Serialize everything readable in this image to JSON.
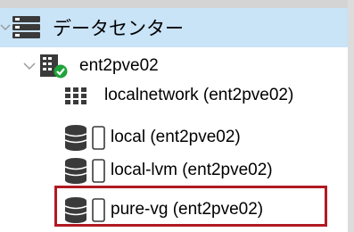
{
  "tree": {
    "datacenter": {
      "label": "データセンター",
      "icon": "server-stack-icon",
      "expanded": true
    },
    "node": {
      "label": "ent2pve02",
      "icon": "node-building-icon",
      "status": "online",
      "status_color": "#1fa33a",
      "expanded": true
    },
    "children": [
      {
        "label": "localnetwork (ent2pve02)",
        "icon": "network-grid-icon"
      },
      {
        "label": "local (ent2pve02)",
        "icon": "storage-icon"
      },
      {
        "label": "local-lvm (ent2pve02)",
        "icon": "storage-icon"
      },
      {
        "label": "pure-vg (ent2pve02)",
        "icon": "storage-icon",
        "highlighted": true
      }
    ]
  },
  "colors": {
    "selected_row": "#c9e3f7",
    "highlight_border": "#b21a22",
    "icon_dark": "#3a3a3a"
  }
}
